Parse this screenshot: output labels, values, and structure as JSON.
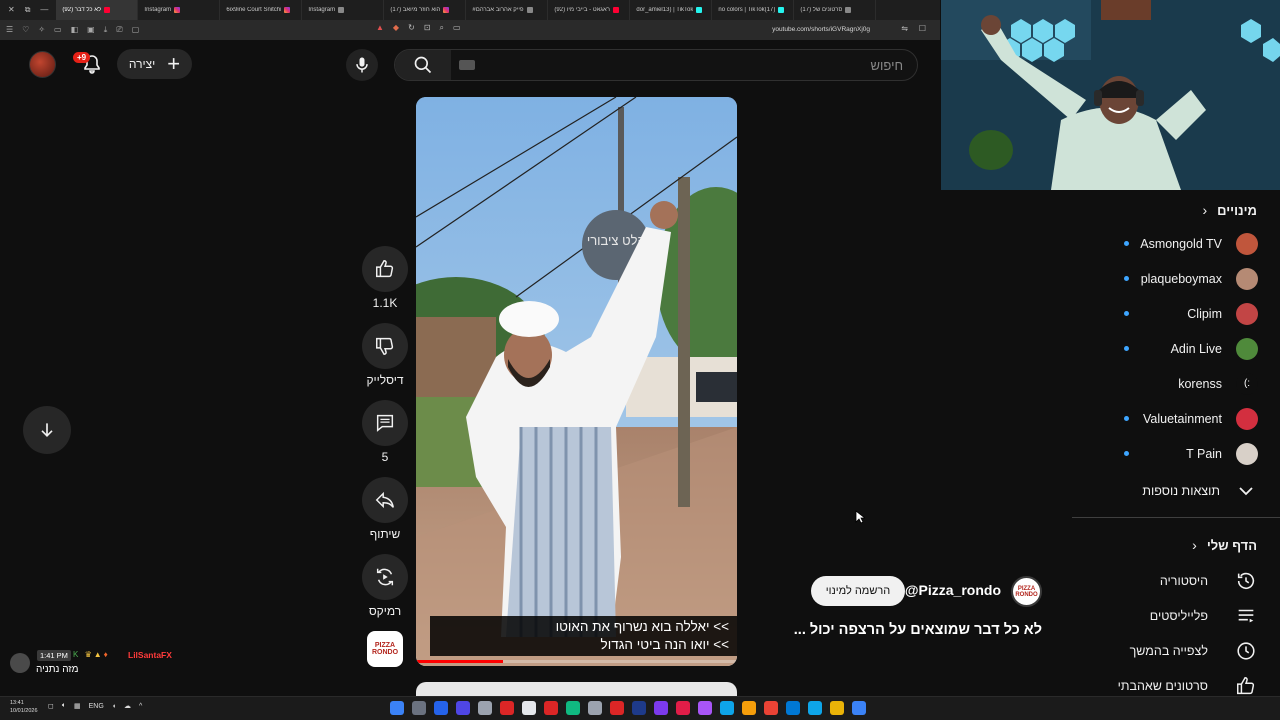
{
  "browser": {
    "tabs": [
      {
        "title": "(92) לא כל דבר",
        "active": true,
        "icon": "youtube-icon"
      },
      {
        "title": "Instagram",
        "icon": "instagram-icon"
      },
      {
        "title": "6ix9ine Court Snitchi",
        "icon": "instagram-icon"
      },
      {
        "title": "Instagram",
        "icon": "generic-icon"
      },
      {
        "title": "(17) הוא חוזר מיואב",
        "icon": "instagram-icon"
      },
      {
        "title": "#פייק אהרוב אברהם",
        "icon": "generic-icon"
      },
      {
        "title": "(92) ראגאט - בייבי מיו",
        "icon": "youtube-icon"
      },
      {
        "title": "dor_amiel13) | TikTok",
        "icon": "tiktok-icon"
      },
      {
        "title": "no colors | TikTok(17)",
        "icon": "tiktok-icon"
      },
      {
        "title": "(17) סרטונים של",
        "icon": "generic-icon"
      }
    ],
    "url": "youtube.com/shorts/iGVRagnXj0g"
  },
  "header": {
    "notification_count": "+9",
    "create_label": "יצירה",
    "search_placeholder": "חיפוש"
  },
  "video": {
    "caption_line1": ">> יאללה בוא נשרוף את האוטו",
    "caption_line2": ">> יואו הנה ביטי הגדול",
    "progress": 0.27,
    "sign_text": "קלט ציבורי"
  },
  "actions": {
    "like_count": "1.1K",
    "dislike_label": "דיסלייק",
    "comment_count": "5",
    "share_label": "שיתוף",
    "remix_label": "רמיקס"
  },
  "channel": {
    "handle": "@Pizza_rondo",
    "subscribe_label": "הרשמה למינוי",
    "logo_text": "PIZZA RONDO"
  },
  "title": "לא כל דבר שמוצאים על הרצפה יכול ...",
  "sidebar": {
    "subscriptions_title": "מינויים",
    "subscriptions": [
      {
        "name": "Asmongold TV",
        "color": "#c0563c",
        "live": true,
        "glyph": ""
      },
      {
        "name": "plaqueboymax",
        "color": "#b58a74",
        "live": true,
        "glyph": ""
      },
      {
        "name": "Clipim",
        "color": "#c24545",
        "live": true,
        "glyph": ""
      },
      {
        "name": "Adin Live",
        "color": "#4f8a3b",
        "live": true,
        "glyph": ""
      },
      {
        "name": "korenss",
        "color": "#0f0f0f",
        "live": false,
        "glyph": ":)"
      },
      {
        "name": "Valuetainment",
        "color": "#d32f3f",
        "live": true,
        "glyph": ""
      },
      {
        "name": "T Pain",
        "color": "#d8d0c8",
        "live": true,
        "glyph": ""
      }
    ],
    "show_more": "תוצאות נוספות",
    "you_title": "הדף שלי",
    "you_items": [
      {
        "label": "היסטוריה",
        "icon": "history-icon"
      },
      {
        "label": "פלייליסטים",
        "icon": "playlists-icon"
      },
      {
        "label": "לצפייה בהמשך",
        "icon": "watch-later-icon"
      },
      {
        "label": "סרטונים שאהבתי",
        "icon": "liked-videos-icon"
      }
    ]
  },
  "chat": {
    "time": "1:41 PM",
    "user": "LilSantaFX",
    "message": "מזה נתניה"
  },
  "taskbar": {
    "time": "13:41",
    "date": "10/01/2026",
    "lang": "ENG"
  }
}
